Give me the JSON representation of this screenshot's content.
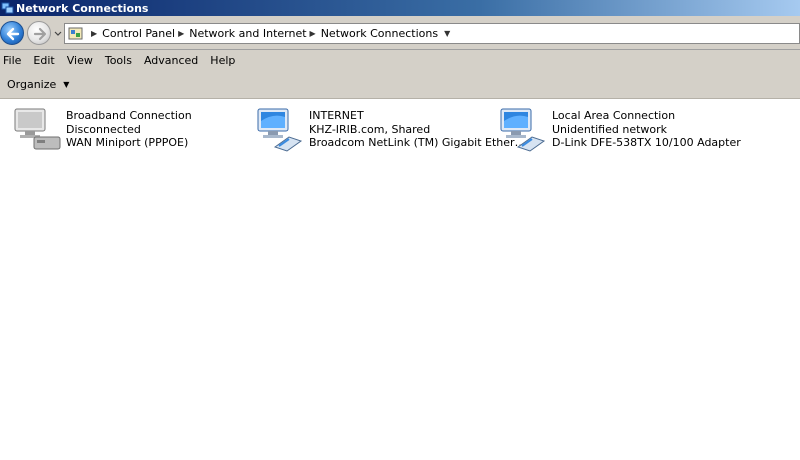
{
  "window": {
    "title": "Network Connections"
  },
  "address": {
    "crumbs": [
      "Control Panel",
      "Network and Internet",
      "Network Connections"
    ]
  },
  "menu": [
    "File",
    "Edit",
    "View",
    "Tools",
    "Advanced",
    "Help"
  ],
  "toolbar": {
    "organize_label": "Organize"
  },
  "connections": [
    {
      "name": "Broadband Connection",
      "status": "Disconnected",
      "device": "WAN Miniport (PPPOE)",
      "icon": "broadband-connection-icon"
    },
    {
      "name": "INTERNET",
      "status": "KHZ-IRIB.com, Shared",
      "device": "Broadcom NetLink (TM) Gigabit Ether…",
      "icon": "network-connection-icon"
    },
    {
      "name": "Local Area Connection",
      "status": "Unidentified network",
      "device": "D-Link DFE-538TX 10/100 Adapter",
      "icon": "network-connection-icon"
    }
  ],
  "colors": {
    "titlebar_start": "#0a246a",
    "chrome": "#d4d0c8",
    "back_button": "#2f7fd7"
  }
}
